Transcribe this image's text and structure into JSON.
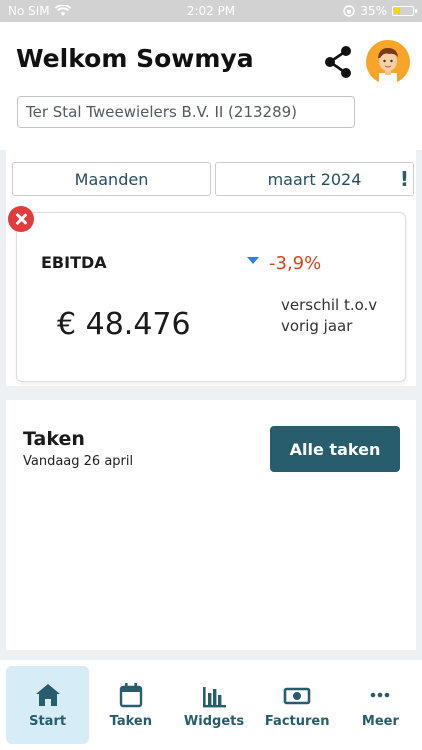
{
  "status_bar": {
    "carrier": "No SIM",
    "time": "2:02 PM",
    "battery": "35%",
    "battery_level": 0.35,
    "icons": [
      "wifi-icon",
      "orientation-lock-icon",
      "battery-icon"
    ]
  },
  "header": {
    "title": "Welkom Sowmya",
    "company": "Ter Stal Tweewielers B.V. II (213289)",
    "icons": [
      "share-icon",
      "avatar"
    ]
  },
  "filters": {
    "period_type": "Maanden",
    "period_value": "maart 2024",
    "warning_mark": "!"
  },
  "kpi": {
    "label": "EBITDA",
    "change": "-3,9%",
    "value": "€ 48.476",
    "note": "verschil t.o.v vorig jaar"
  },
  "tasks": {
    "title": "Taken",
    "date": "Vandaag 26 april",
    "button_label": "Alle taken"
  },
  "nav": {
    "items": [
      {
        "label": "Start",
        "icon": "home-icon",
        "active": true
      },
      {
        "label": "Taken",
        "icon": "calendar-icon",
        "active": false
      },
      {
        "label": "Widgets",
        "icon": "bar-chart-icon",
        "active": false
      },
      {
        "label": "Facturen",
        "icon": "banknote-icon",
        "active": false
      },
      {
        "label": "Meer",
        "icon": "more-icon",
        "active": false
      }
    ]
  },
  "colors": {
    "accent": "#275d6c",
    "negative": "#d9421f",
    "trend_arrow": "#2f7fdb",
    "close_badge": "#e23b3b",
    "avatar_bg": "#f6a528",
    "nav_active_bg": "#d6ecf6"
  }
}
